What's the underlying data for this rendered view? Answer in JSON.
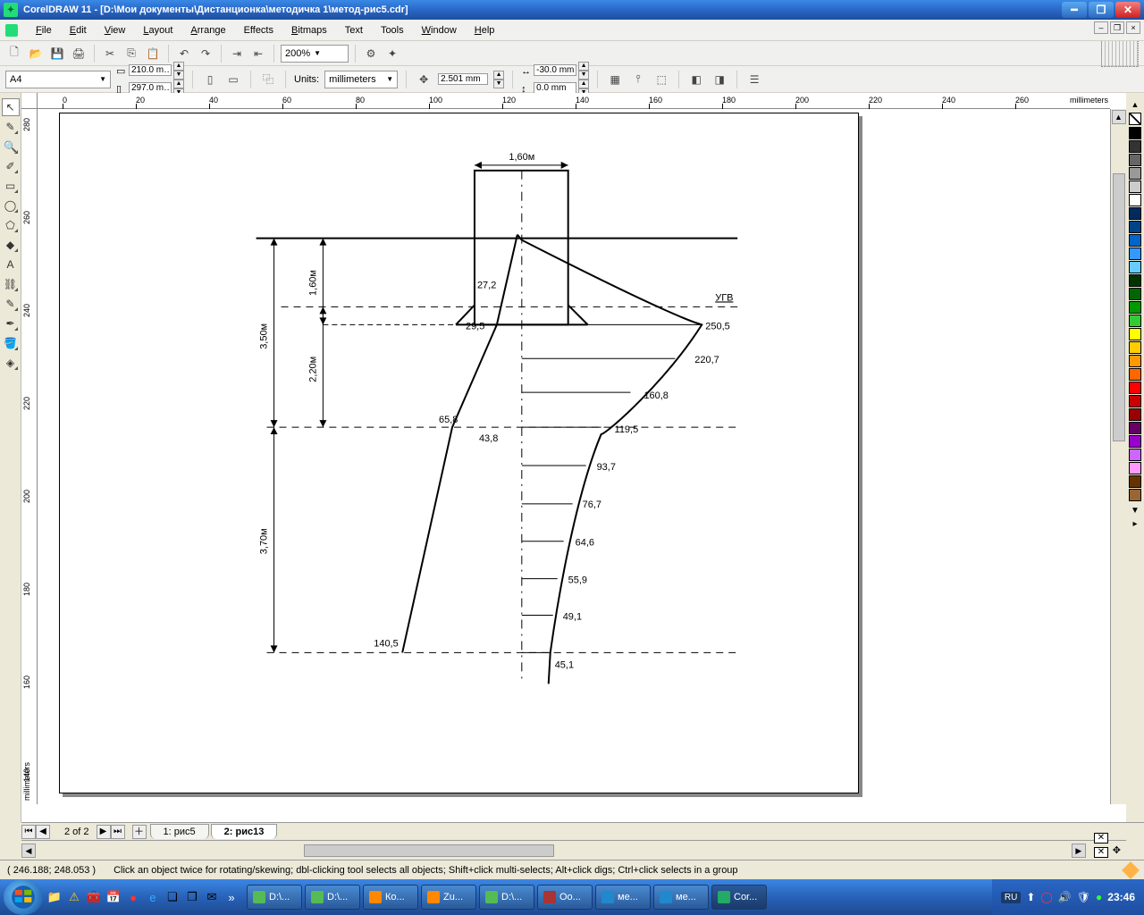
{
  "title": "CorelDRAW 11 - [D:\\Мои документы\\Дистанционка\\методичка 1\\метод-рис5.cdr]",
  "menu": {
    "items": [
      "File",
      "Edit",
      "View",
      "Layout",
      "Arrange",
      "Effects",
      "Bitmaps",
      "Text",
      "Tools",
      "Window",
      "Help"
    ]
  },
  "zoom": "200%",
  "paper": "A4",
  "pagedims": {
    "w": "210.0 m…",
    "h": "297.0 m…"
  },
  "units_label": "Units:",
  "units_value": "millimeters",
  "nudge": "2.501 mm",
  "dup": {
    "x": "-30.0 mm",
    "y": "0.0 mm"
  },
  "ruler_units": "millimeters",
  "hruler_ticks": [
    "0",
    "20",
    "40",
    "60",
    "80",
    "100",
    "120",
    "140",
    "160",
    "180",
    "200",
    "220",
    "240",
    "260"
  ],
  "vruler_ticks": [
    "280",
    "260",
    "240",
    "220",
    "200",
    "180",
    "160",
    "140"
  ],
  "tabnav": {
    "page_of": "2 of 2"
  },
  "tabs": [
    {
      "label": "1: рис5",
      "active": false
    },
    {
      "label": "2: рис13",
      "active": true
    }
  ],
  "status": {
    "coords": "( 246.188; 248.053 )",
    "hint": "Click an object twice for rotating/skewing; dbl-clicking tool selects all objects; Shift+click multi-selects; Alt+click digs; Ctrl+click selects in a group"
  },
  "taskbar": {
    "items": [
      {
        "label": "D:\\...",
        "color": "#5b5"
      },
      {
        "label": "D:\\...",
        "color": "#5b5"
      },
      {
        "label": "Ко...",
        "color": "#f80"
      },
      {
        "label": "Zu...",
        "color": "#f80"
      },
      {
        "label": "D:\\...",
        "color": "#5b5"
      },
      {
        "label": "Оо...",
        "color": "#a33"
      },
      {
        "label": "ме...",
        "color": "#28c"
      },
      {
        "label": "ме...",
        "color": "#28c"
      },
      {
        "label": "Cor...",
        "color": "#2a6",
        "active": true
      }
    ],
    "lang": "RU",
    "clock": "23:46"
  },
  "palette": [
    "#000000",
    "#333333",
    "#666666",
    "#999999",
    "#cccccc",
    "#ffffff",
    "#002a5c",
    "#004488",
    "#0066cc",
    "#3399ff",
    "#66ccff",
    "#003300",
    "#006600",
    "#009900",
    "#33cc33",
    "#ffff00",
    "#ffcc00",
    "#ff9900",
    "#ff6600",
    "#ff0000",
    "#cc0000",
    "#990000",
    "#660066",
    "#9900cc",
    "#cc66ff",
    "#ff99ff",
    "#663300",
    "#996633"
  ],
  "drawing": {
    "top_dim": "1,60м",
    "v_dims": [
      "1,60м",
      "3,50м",
      "2,20м",
      "3,70м"
    ],
    "ugv": "УГВ",
    "left_vals": [
      "27,2",
      "29,5",
      "65,8",
      "43,8",
      "140,5"
    ],
    "right_vals": [
      "250,5",
      "220,7",
      "160,8",
      "119,5",
      "93,7",
      "76,7",
      "64,6",
      "55,9",
      "49,1",
      "45,1"
    ]
  }
}
